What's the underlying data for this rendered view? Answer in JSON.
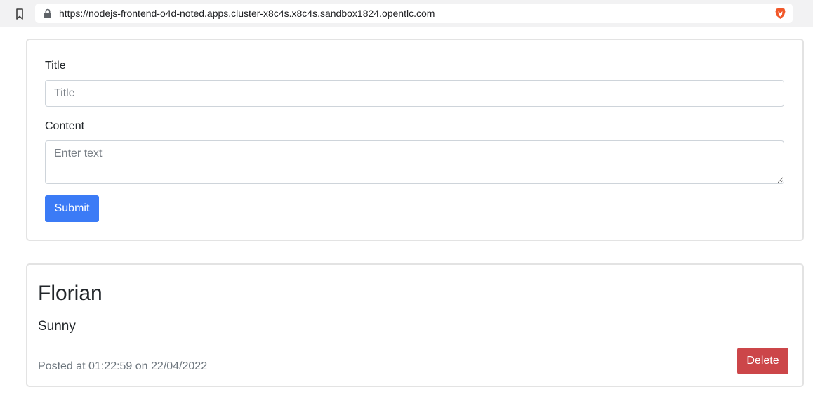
{
  "browser": {
    "url": "https://nodejs-frontend-o4d-noted.apps.cluster-x8c4s.x8c4s.sandbox1824.opentlc.com",
    "icons": [
      "bookmark-icon",
      "lock-icon",
      "brave-shield-icon"
    ]
  },
  "form": {
    "title_label": "Title",
    "title_placeholder": "Title",
    "title_value": "",
    "content_label": "Content",
    "content_placeholder": "Enter text",
    "content_value": "",
    "submit_label": "Submit"
  },
  "notes": [
    {
      "title": "Florian",
      "content": "Sunny",
      "meta": "Posted at 01:22:59 on 22/04/2022",
      "delete_label": "Delete"
    }
  ],
  "colors": {
    "primary": "#3b7bf6",
    "danger": "#cc4649",
    "muted": "#6c757d"
  }
}
